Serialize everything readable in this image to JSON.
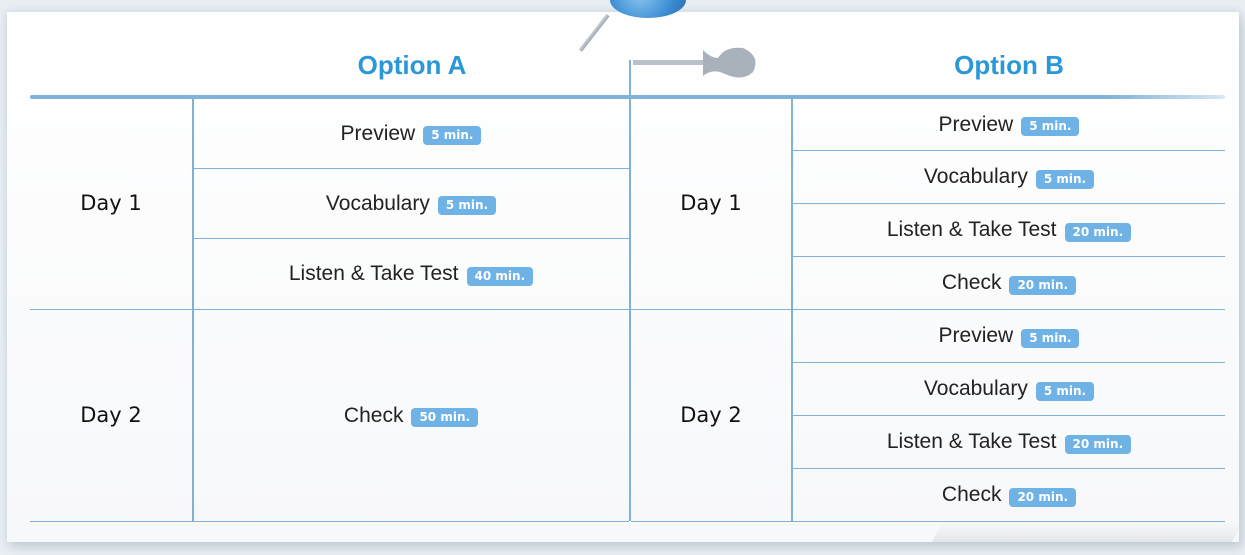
{
  "table": {
    "option_a": {
      "title": "Option A",
      "day1": {
        "label": "Day 1",
        "items": [
          {
            "label": "Preview",
            "time": "5 min."
          },
          {
            "label": "Vocabulary",
            "time": "5 min."
          },
          {
            "label": "Listen & Take Test",
            "time": "40 min."
          }
        ]
      },
      "day2": {
        "label": "Day 2",
        "items": [
          {
            "label": "Check",
            "time": "50 min."
          }
        ]
      }
    },
    "option_b": {
      "title": "Option B",
      "day1": {
        "label": "Day 1",
        "items": [
          {
            "label": "Preview",
            "time": "5 min."
          },
          {
            "label": "Vocabulary",
            "time": "5 min."
          },
          {
            "label": "Listen & Take Test",
            "time": "20 min."
          },
          {
            "label": "Check",
            "time": "20 min."
          }
        ]
      },
      "day2": {
        "label": "Day 2",
        "items": [
          {
            "label": "Preview",
            "time": "5 min."
          },
          {
            "label": "Vocabulary",
            "time": "5 min."
          },
          {
            "label": "Listen & Take Test",
            "time": "20 min."
          },
          {
            "label": "Check",
            "time": "20 min."
          }
        ]
      }
    }
  },
  "colors": {
    "accent": "#2a97d6",
    "badge": "#6fb2e6",
    "rule": "#7fb1d9"
  }
}
